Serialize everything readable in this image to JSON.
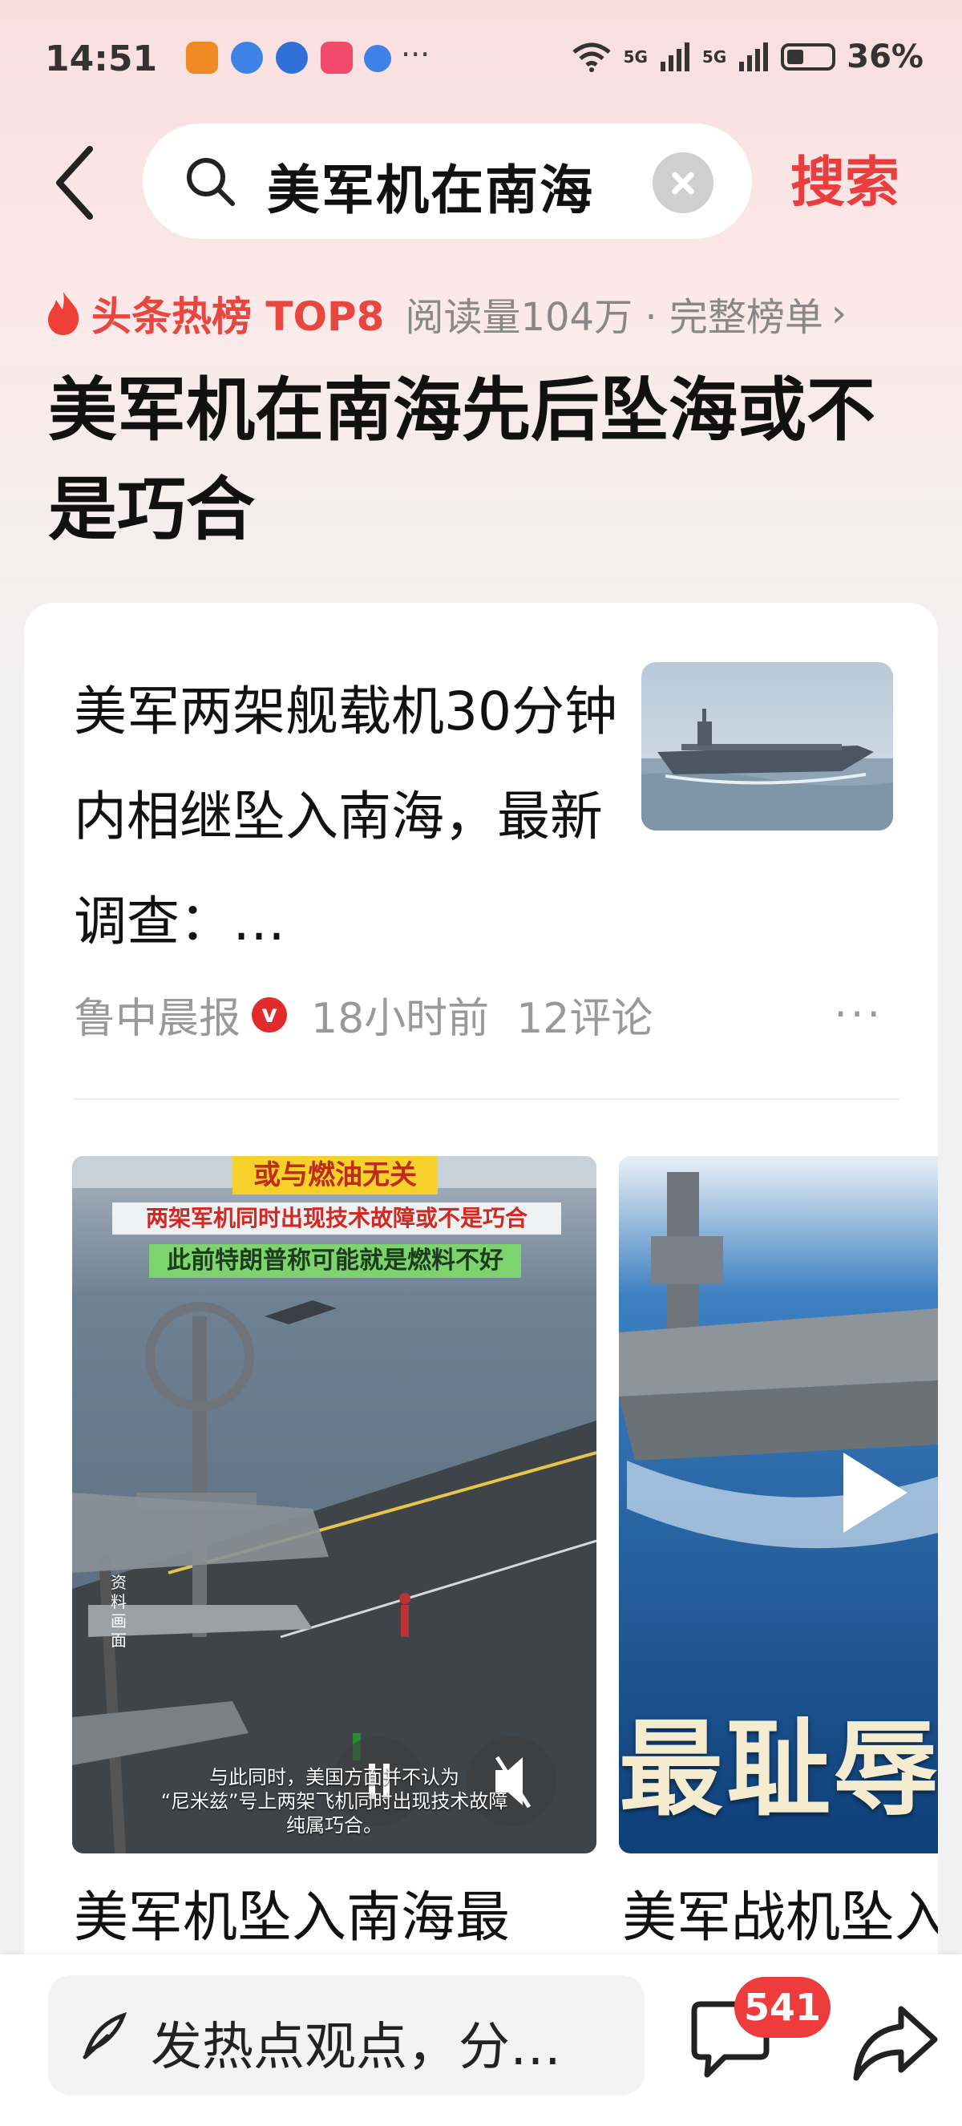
{
  "status_bar": {
    "time": "14:51",
    "dots": "···",
    "network_1": "5G",
    "network_2": "5G",
    "battery": "36%"
  },
  "search": {
    "query": "美军机在南海",
    "submit_label": "搜索"
  },
  "hot": {
    "label": "头条热榜 TOP8",
    "meta": "阅读量104万 · 完整榜单",
    "chevron": "›",
    "headline": "美军机在南海先后坠海或不是巧合"
  },
  "article": {
    "title": "美军两架舰载机30分钟内相继坠入南海，最新调查：…",
    "source": "鲁中晨报",
    "verified": "v",
    "time": "18小时前",
    "comments": "12评论",
    "more": "···"
  },
  "videos": [
    {
      "title": "美军机坠入南海最",
      "caption_top": "或与燃油无关",
      "caption_red": "两架军机同时出现技术故障或不是巧合",
      "caption_green": "此前特朗普称可能就是燃料不好",
      "side_label": "资料画面",
      "subtitle_1": "与此同时，美国方面并不认为",
      "subtitle_2": "“尼米兹”号上两架飞机同时出现技术故障",
      "subtitle_3": "纯属巧合。"
    },
    {
      "title": "美军战机坠入",
      "overlay_text": "最耻辱"
    }
  ],
  "bottom": {
    "comment_placeholder": "发热点观点，分…",
    "comment_count": "541"
  },
  "colors": {
    "accent_red": "#ea3d3d",
    "badge_red": "#ee3b3b",
    "hero_pink": "#f9dede"
  }
}
